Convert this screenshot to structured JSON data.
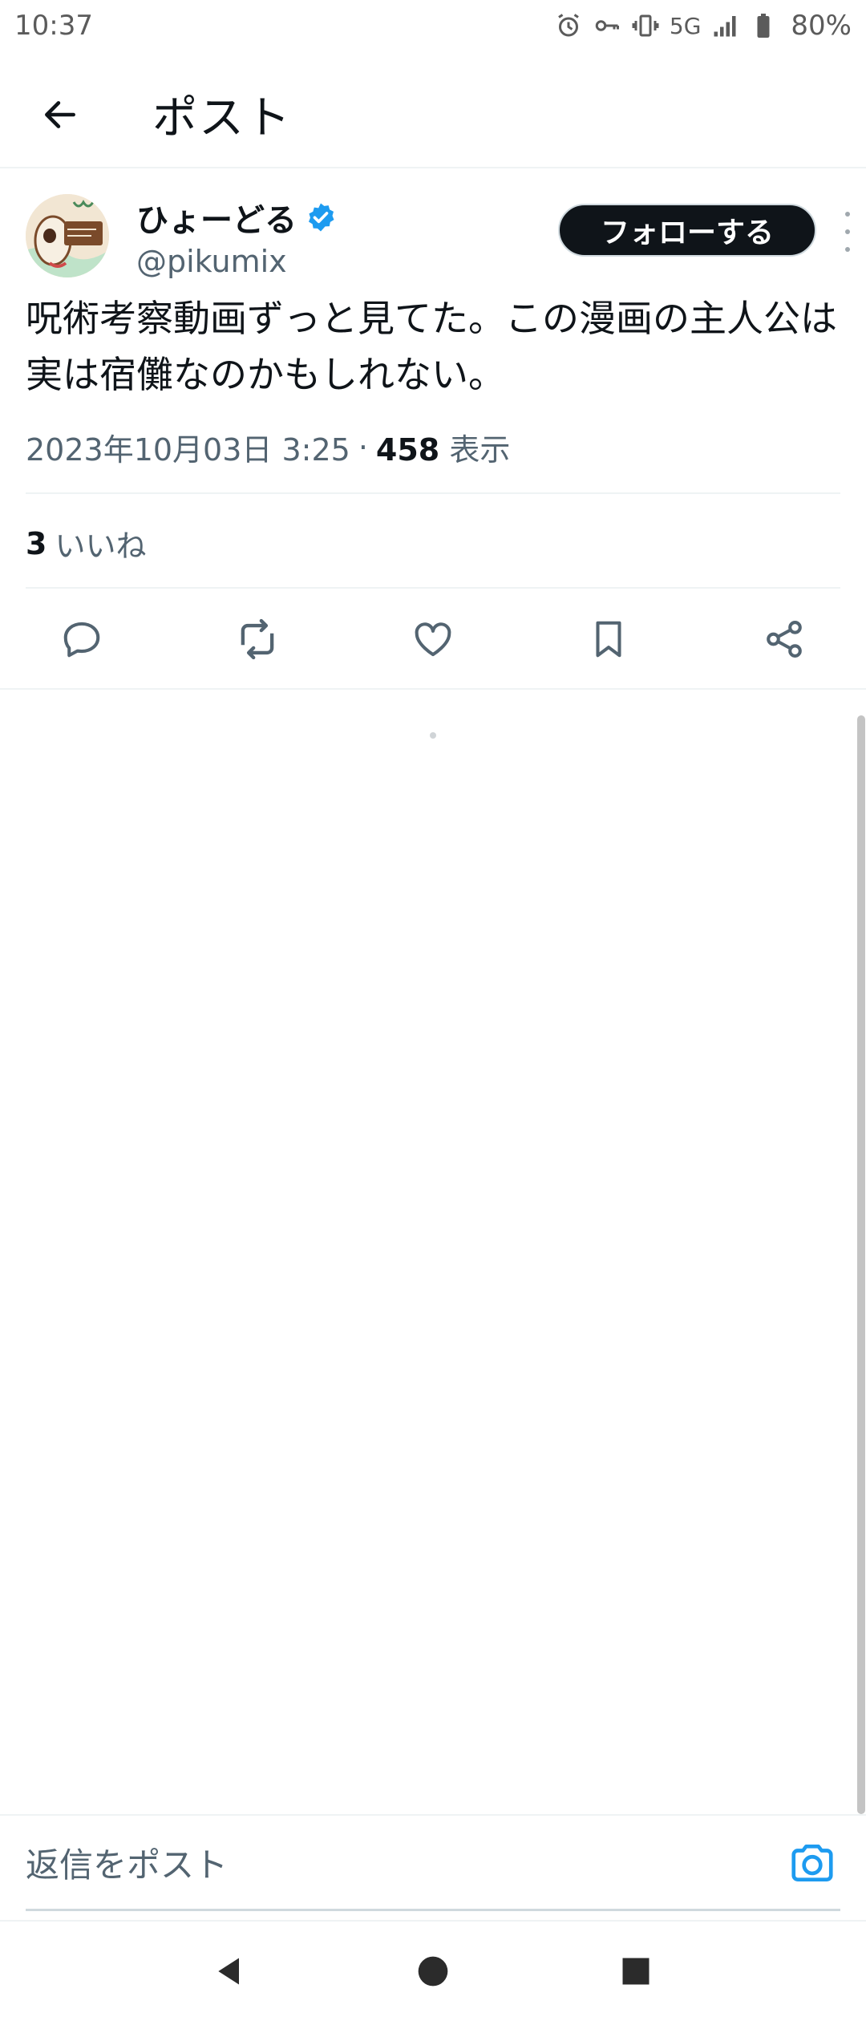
{
  "status_bar": {
    "time": "10:37",
    "network": "5G",
    "battery": "80%",
    "icons": [
      "alarm-icon",
      "vpn-key-icon",
      "vibrate-icon",
      "signal-icon",
      "battery-icon"
    ]
  },
  "header": {
    "title": "ポスト",
    "back_icon": "arrow-left-icon"
  },
  "post": {
    "author": {
      "display_name": "ひょーどる",
      "handle": "@pikumix",
      "verified": true
    },
    "follow_label": "フォローする",
    "text": "呪術考察動画ずっと見てた。この漫画の主人公は実は宿儺なのかもしれない。",
    "timestamp": "2023年10月03日 3:25",
    "separator": "·",
    "views_count": "458",
    "views_label": "表示",
    "likes_count": "3",
    "likes_label": "いいね"
  },
  "actions": [
    "reply-icon",
    "retweet-icon",
    "like-icon",
    "bookmark-icon",
    "share-icon"
  ],
  "reply_bar": {
    "placeholder": "返信をポスト",
    "camera_icon": "camera-icon"
  },
  "colors": {
    "text": "#0f1419",
    "secondary": "#536471",
    "accent": "#1d9bf0",
    "divider": "#eff3f4"
  }
}
